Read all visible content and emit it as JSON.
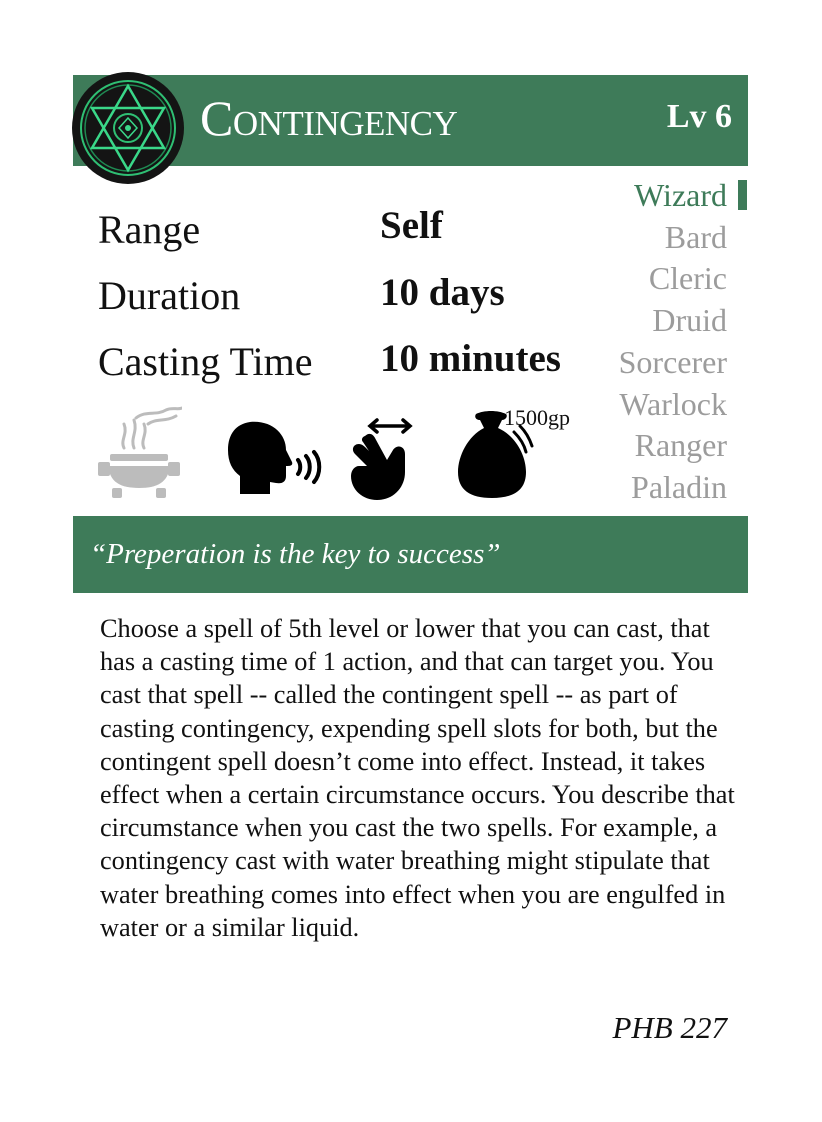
{
  "spell": {
    "name": "Contingency",
    "level": "Lv 6"
  },
  "stats": {
    "range_label": "Range",
    "range_value": "Self",
    "duration_label": "Duration",
    "duration_value": "10 days",
    "casting_time_label": "Casting Time",
    "casting_time_value": "10 minutes"
  },
  "classes": [
    {
      "name": "Wizard",
      "active": true
    },
    {
      "name": "Bard",
      "active": false
    },
    {
      "name": "Cleric",
      "active": false
    },
    {
      "name": "Druid",
      "active": false
    },
    {
      "name": "Sorcerer",
      "active": false
    },
    {
      "name": "Warlock",
      "active": false
    },
    {
      "name": "Ranger",
      "active": false
    },
    {
      "name": "Paladin",
      "active": false
    }
  ],
  "components": {
    "icons": [
      "ritual-brazier-icon",
      "verbal-speaking-head-icon",
      "somatic-hand-icon",
      "material-pouch-icon"
    ],
    "material_cost": "1500gp"
  },
  "quote": "“Preperation is the key to success”",
  "description": "Choose a spell of 5th level or lower that you can cast, that has a casting time of 1 action, and that can target you. You cast that spell -- called the contingent spell -- as part of casting contingency, expending spell slots for both, but the contingent spell doesn’t come into effect. Instead, it takes effect when a certain circumstance occurs. You describe that circumstance when you cast the two spells. For example, a contingency cast with water breathing might stipulate that water breathing comes into effect when you are engulfed in water or a similar liquid.",
  "source": "PHB 227",
  "colors": {
    "accent": "#3e7b59",
    "inactive_class": "#9c9c9c",
    "emblem_glow": "#2fbf73"
  }
}
